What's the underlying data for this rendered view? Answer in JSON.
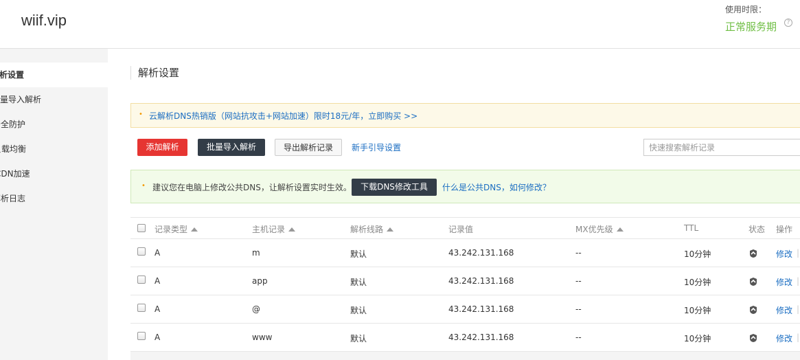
{
  "header": {
    "site": "wiif.vip",
    "usage_label": "使用时限：",
    "usage_status": "正常服务期",
    "help_icon": "?"
  },
  "sidebar": {
    "items": [
      {
        "label": "解析设置",
        "active": true
      },
      {
        "label": "批量导入解析"
      },
      {
        "label": "安全防护"
      },
      {
        "label": "负载均衡"
      },
      {
        "label": "CDN加速"
      },
      {
        "label": "解析日志"
      }
    ]
  },
  "main": {
    "title": "解析设置",
    "promo": "云解析DNS热销版（网站抗攻击+网站加速）限时18元/年，立即购买 >>",
    "toolbar": {
      "add_label": "添加解析",
      "batch_label": "批量导入解析",
      "export_label": "导出解析记录",
      "guide_label": "新手引导设置",
      "search_placeholder": "快速搜索解析记录"
    },
    "tip": {
      "text": "建议您在电脑上修改公共DNS，让解析设置实时生效。",
      "button": "下载DNS修改工具",
      "link": "什么是公共DNS，如何修改？"
    }
  },
  "table": {
    "headers": [
      "记录类型",
      "主机记录",
      "解析线路",
      "记录值",
      "MX优先级",
      "TTL",
      "状态",
      "操作"
    ],
    "rows": [
      {
        "type": "A",
        "host": "m",
        "line": "默认",
        "value": "43.242.131.168",
        "mx": "--",
        "ttl": "10分钟",
        "action": "修改"
      },
      {
        "type": "A",
        "host": "app",
        "line": "默认",
        "value": "43.242.131.168",
        "mx": "--",
        "ttl": "10分钟",
        "action": "修改"
      },
      {
        "type": "A",
        "host": "@",
        "line": "默认",
        "value": "43.242.131.168",
        "mx": "--",
        "ttl": "10分钟",
        "action": "修改"
      },
      {
        "type": "A",
        "host": "www",
        "line": "默认",
        "value": "43.242.131.168",
        "mx": "--",
        "ttl": "10分钟",
        "action": "修改"
      }
    ],
    "separator": "|"
  }
}
